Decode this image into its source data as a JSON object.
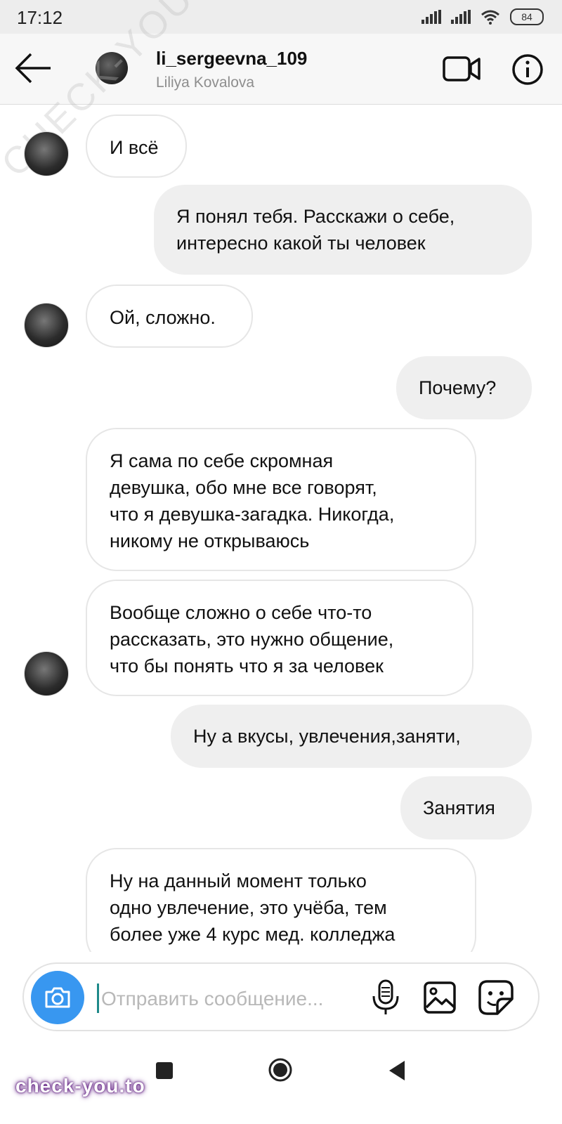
{
  "status_bar": {
    "time": "17:12",
    "battery": "84"
  },
  "header": {
    "username": "li_sergeevna_109",
    "full_name": "Liliya Kovalova"
  },
  "watermark": "CHECK-YOU.ME",
  "messages": [
    {
      "direction": "incoming",
      "text": "И всё",
      "show_avatar": true
    },
    {
      "direction": "outgoing",
      "text": "Я понял тебя. Расскажи о себе,\nинтересно какой ты человек"
    },
    {
      "direction": "incoming",
      "text": "Ой, сложно.",
      "show_avatar": true
    },
    {
      "direction": "outgoing",
      "text": "Почему?"
    },
    {
      "direction": "incoming",
      "text": "Я сама по себе скромная\nдевушка, обо мне все говорят,\nчто я девушка-загадка. Никогда,\nникому не открываюсь",
      "show_avatar": false
    },
    {
      "direction": "incoming",
      "text": "Вообще сложно о себе что-то\nрассказать, это нужно общение,\nчто бы понять что я за человек",
      "show_avatar": true
    },
    {
      "direction": "outgoing",
      "text": "Ну а вкусы, увлечения,заняти,"
    },
    {
      "direction": "outgoing",
      "text": "Занятия"
    },
    {
      "direction": "incoming",
      "text": "Ну на данный момент только\nодно увлечение, это учёба, тем\nболее уже 4 курс мед. колледжа",
      "show_avatar": false
    }
  ],
  "composer": {
    "placeholder": "Отправить сообщение..."
  },
  "icons": {
    "back": "arrow-left-icon",
    "video": "video-camera-icon",
    "info": "info-icon",
    "camera": "camera-icon",
    "mic": "microphone-icon",
    "gallery": "image-icon",
    "sticker": "sticker-icon"
  },
  "colors": {
    "accent": "#3897f0",
    "outgoing_bubble": "#efefef",
    "incoming_border": "#e6e6e6"
  },
  "brand": "check-you.to"
}
